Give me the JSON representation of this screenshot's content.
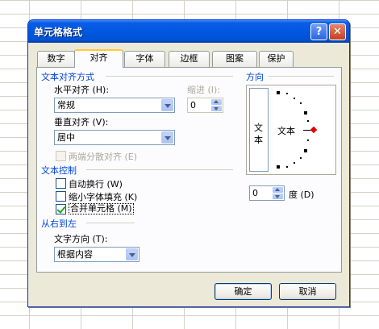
{
  "dialog": {
    "title": "单元格格式",
    "help_label": "?",
    "close_label": "✕"
  },
  "tabs": [
    {
      "label": "数字"
    },
    {
      "label": "对齐"
    },
    {
      "label": "字体"
    },
    {
      "label": "边框"
    },
    {
      "label": "图案"
    },
    {
      "label": "保护"
    }
  ],
  "active_tab": "对齐",
  "text_alignment": {
    "section_label": "文本对齐方式",
    "horizontal_label": "水平对齐 (H):",
    "horizontal_value": "常规",
    "indent_label": "缩进 (I):",
    "indent_value": "0",
    "vertical_label": "垂直对齐 (V):",
    "vertical_value": "居中",
    "distributed_label": "两端分散对齐 (E)"
  },
  "text_control": {
    "section_label": "文本控制",
    "wrap_label": "自动换行 (W)",
    "wrap_checked": false,
    "shrink_label": "缩小字体填充 (K)",
    "shrink_checked": false,
    "merge_label": "合并单元格 (M)",
    "merge_checked": true
  },
  "rtl": {
    "section_label": "从右到左",
    "direction_label": "文字方向 (T):",
    "direction_value": "根据内容"
  },
  "orientation": {
    "section_label": "方向",
    "vertical_text": [
      "文",
      "本"
    ],
    "horizontal_text": "文本",
    "degrees_value": "0",
    "degrees_label": "度 (D)"
  },
  "buttons": {
    "ok_label": "确定",
    "cancel_label": "取消"
  },
  "colors": {
    "title_bar": "#0058e0",
    "section_text": "#0046d5",
    "active_tab_highlight": "#ffc83c",
    "orientation_marker": "#e00000"
  }
}
